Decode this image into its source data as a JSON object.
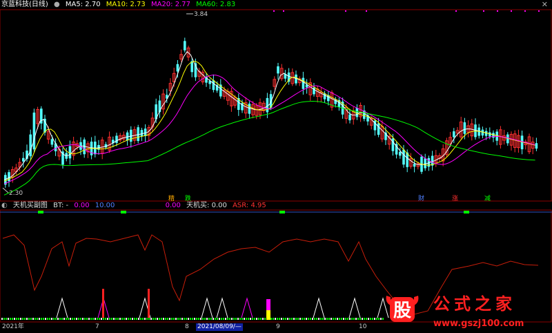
{
  "main_header": {
    "stock_name": "京蓝科技(日线)",
    "ma5": "MA5: 2.70",
    "ma10": "MA10: 2.73",
    "ma20": "MA20: 2.77",
    "ma60": "MA60: 2.83"
  },
  "price_labels": {
    "high": "3.84",
    "low": "2.30"
  },
  "signal_labels": [
    {
      "text": "精",
      "color": "#ffaa00"
    },
    {
      "text": "跌",
      "color": "#00ff00"
    },
    {
      "text": "财",
      "color": "#5080ff"
    },
    {
      "text": "涨",
      "color": "#ff3030"
    },
    {
      "text": "减",
      "color": "#00ff00"
    }
  ],
  "sub_header": {
    "title": "天机买副图",
    "bt": "BT: -",
    "v1": "0.00",
    "v2": "10.00",
    "v3": "0.00",
    "buy": "天机买: 0.00",
    "asr": "ASR: 4.95"
  },
  "dates": [
    "2021年",
    "7",
    "8",
    "2021/08/09/—",
    "9",
    "10"
  ],
  "watermark": {
    "char": "股",
    "text": "公式之家",
    "url": "www.gszj100.com"
  },
  "colors": {
    "up": "#ff3030",
    "down": "#54ffff",
    "ma5": "#ffffff",
    "ma10": "#ffff00",
    "ma20": "#ff00ff",
    "ma60": "#00ff00",
    "asr": "#c81e0a"
  }
}
